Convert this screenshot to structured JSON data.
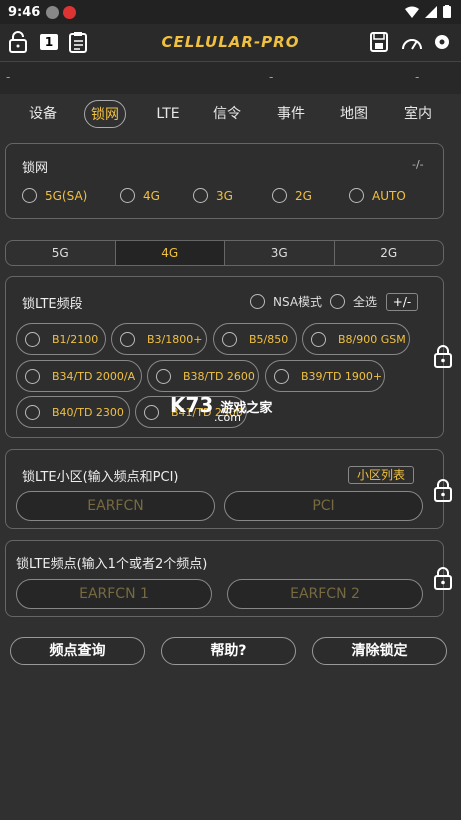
{
  "status": {
    "time": "9:46"
  },
  "app": {
    "title": "CELLULAR-PRO",
    "counter": "1"
  },
  "dashes": [
    "-",
    "-",
    "-"
  ],
  "tabs": [
    {
      "label": "设备"
    },
    {
      "label": "锁网"
    },
    {
      "label": "LTE"
    },
    {
      "label": "信令"
    },
    {
      "label": "事件"
    },
    {
      "label": "地图"
    },
    {
      "label": "室内"
    }
  ],
  "lock_network": {
    "title": "锁网",
    "reset": "-/-",
    "options": [
      "5G(SA)",
      "4G",
      "3G",
      "2G",
      "AUTO"
    ]
  },
  "bands_tabs": [
    "5G",
    "4G",
    "3G",
    "2G"
  ],
  "lte_band": {
    "title": "锁LTE频段",
    "nsa": "NSA模式",
    "select_all": "全选",
    "toggle": "+/-",
    "bands": [
      "B1/2100",
      "B3/1800+",
      "B5/850",
      "B8/900 GSM",
      "B34/TD 2000/A",
      "B38/TD 2600",
      "B39/TD 1900+",
      "B40/TD 2300",
      "B41/TD 2500"
    ]
  },
  "lte_cell": {
    "title": "锁LTE小区(输入频点和PCI)",
    "list_btn": "小区列表",
    "earfcn_placeholder": "EARFCN",
    "pci_placeholder": "PCI"
  },
  "lte_freq": {
    "title": "锁LTE频点(输入1个或者2个频点)",
    "earfcn1_placeholder": "EARFCN 1",
    "earfcn2_placeholder": "EARFCN 2"
  },
  "buttons": {
    "query": "频点查询",
    "help": "帮助?",
    "clear": "清除锁定"
  },
  "watermark": {
    "brand": "K73",
    "text": "游戏之家",
    "domain": ".com"
  }
}
